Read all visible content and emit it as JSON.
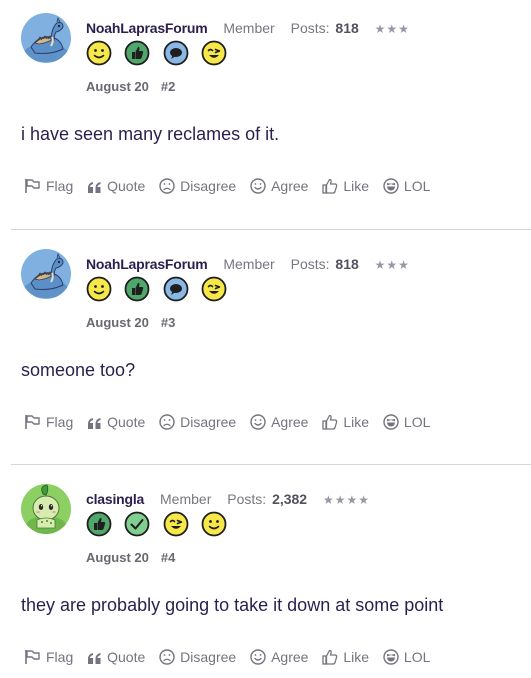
{
  "posts": [
    {
      "username": "NoahLaprasForum",
      "role": "Member",
      "posts_label": "Posts:",
      "posts_count": "818",
      "stars": "★★★",
      "badges": [
        "smile-yellow",
        "thumbs-up-green",
        "speech-bubble-blue",
        "wink-yellow"
      ],
      "date": "August 20",
      "number": "#2",
      "content": "i have seen many reclames of it.",
      "avatar": "lapras"
    },
    {
      "username": "NoahLaprasForum",
      "role": "Member",
      "posts_label": "Posts:",
      "posts_count": "818",
      "stars": "★★★",
      "badges": [
        "smile-yellow",
        "thumbs-up-green",
        "speech-bubble-blue",
        "wink-yellow"
      ],
      "date": "August 20",
      "number": "#3",
      "content": "someone too?",
      "avatar": "lapras"
    },
    {
      "username": "clasingla",
      "role": "Member",
      "posts_label": "Posts:",
      "posts_count": "2,382",
      "stars": "★★★★",
      "badges": [
        "thumbs-up-green",
        "checkmark-green",
        "wink-yellow",
        "smile-yellow"
      ],
      "date": "August 20",
      "number": "#4",
      "content": "they are probably going to take it down at some point",
      "avatar": "chikorita"
    }
  ],
  "actions": {
    "flag": "Flag",
    "quote": "Quote",
    "disagree": "Disagree",
    "agree": "Agree",
    "like": "Like",
    "lol": "LOL"
  },
  "colors": {
    "text": "#2b1f4e",
    "muted": "#757380",
    "divider": "#d8d6dc",
    "badge_yellow": "#f7e84a",
    "badge_green": "#4fa76b",
    "badge_blue": "#8ab8e6"
  }
}
